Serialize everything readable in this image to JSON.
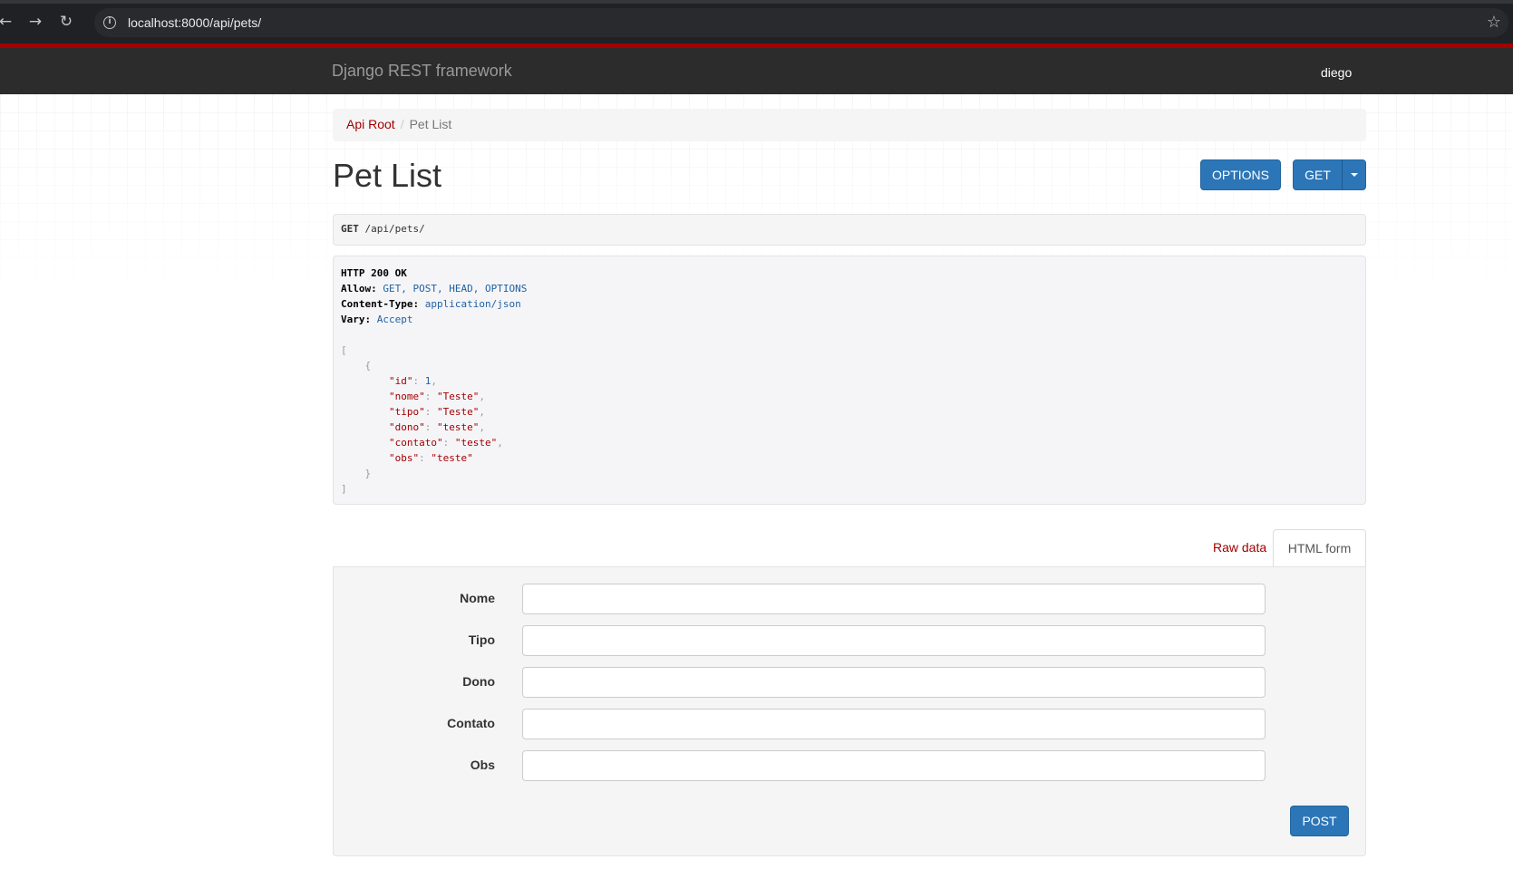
{
  "browser": {
    "url": "localhost:8000/api/pets/",
    "back_icon": "←",
    "forward_icon": "→",
    "reload_icon": "↻",
    "info_icon": "i",
    "star_icon": "☆"
  },
  "navbar": {
    "brand": "Django REST framework",
    "user": "diego",
    "accent_color": "#a30000"
  },
  "breadcrumb": {
    "root": "Api Root",
    "separator": "/",
    "current": "Pet List"
  },
  "page": {
    "title": "Pet List"
  },
  "actions": {
    "options_label": "OPTIONS",
    "get_label": "GET"
  },
  "request": {
    "method": "GET",
    "path": "/api/pets/"
  },
  "response": {
    "status": "HTTP 200 OK",
    "headers": [
      {
        "key": "Allow",
        "value": "GET, POST, HEAD, OPTIONS"
      },
      {
        "key": "Content-Type",
        "value": "application/json"
      },
      {
        "key": "Vary",
        "value": "Accept"
      }
    ],
    "open_array": "[",
    "open_object": "{",
    "fields": [
      {
        "key": "\"id\"",
        "value": "1",
        "type": "num"
      },
      {
        "key": "\"nome\"",
        "value": "\"Teste\"",
        "type": "str"
      },
      {
        "key": "\"tipo\"",
        "value": "\"Teste\"",
        "type": "str"
      },
      {
        "key": "\"dono\"",
        "value": "\"teste\"",
        "type": "str"
      },
      {
        "key": "\"contato\"",
        "value": "\"teste\"",
        "type": "str"
      },
      {
        "key": "\"obs\"",
        "value": "\"teste\"",
        "type": "str"
      }
    ],
    "close_object": "}",
    "close_array": "]"
  },
  "tabs": {
    "raw": "Raw data",
    "html": "HTML form"
  },
  "form": {
    "fields": [
      {
        "label": "Nome",
        "value": ""
      },
      {
        "label": "Tipo",
        "value": ""
      },
      {
        "label": "Dono",
        "value": ""
      },
      {
        "label": "Contato",
        "value": ""
      },
      {
        "label": "Obs",
        "value": ""
      }
    ],
    "submit_label": "POST"
  }
}
